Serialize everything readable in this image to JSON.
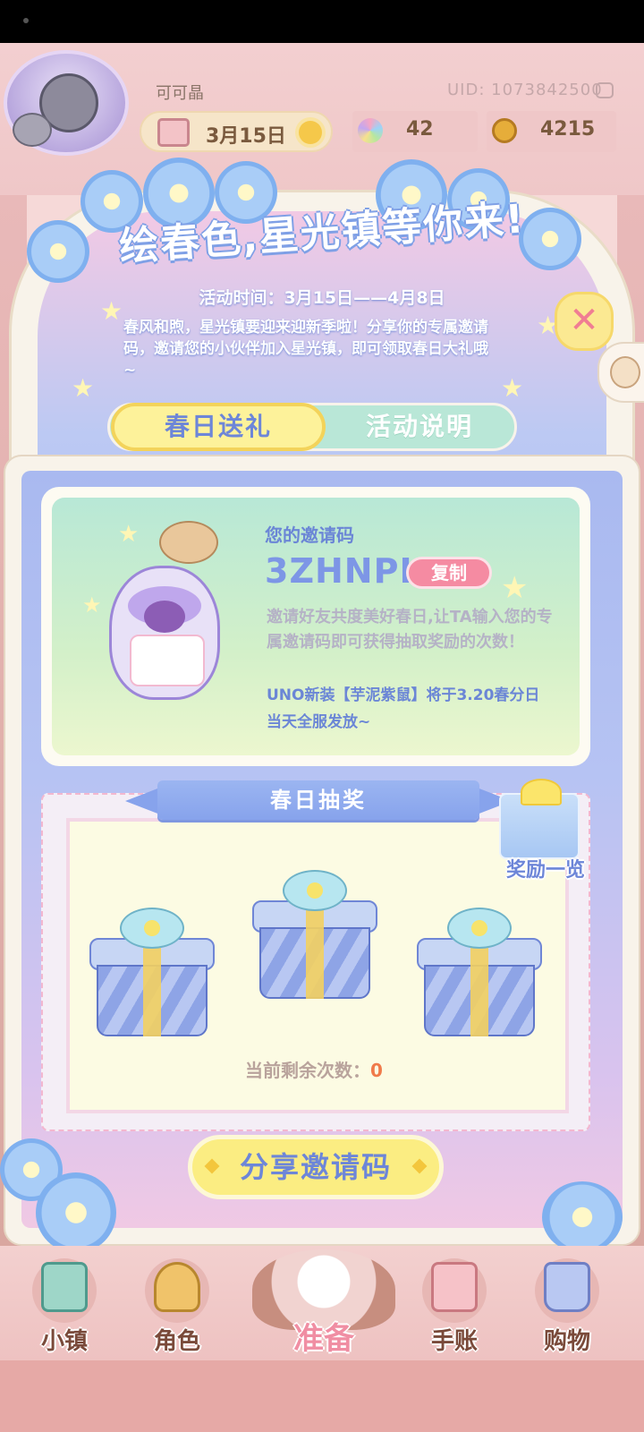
{
  "header": {
    "username": "可可晶",
    "uid": "UID: 1073842500",
    "date": "3月15日",
    "flower_count": "42",
    "coin_count": "4215"
  },
  "event": {
    "title": "绘春色,星光镇等你来!",
    "time": "活动时间：3月15日——4月8日",
    "description": "春风和煦，星光镇要迎来迎新季啦！分享你的专属邀请码，邀请您的小伙伴加入星光镇，即可领取春日大礼哦~",
    "close_symbol": "✕"
  },
  "tabs": {
    "active": "春日送礼",
    "inactive": "活动说明"
  },
  "invite": {
    "label": "您的邀请码",
    "code": "3ZHNPH",
    "copy_label": "复制",
    "description": "邀请好友共度美好春日,让TA输入您的专属邀请码即可获得抽取奖励的次数！",
    "note": "UNO新装【芋泥紫鼠】将于3.20春分日当天全服发放~"
  },
  "lottery": {
    "title": "春日抽奖",
    "rewards_label": "奖励一览",
    "remaining_label": "当前剩余次数：",
    "remaining_count": "0"
  },
  "share_button": "分享邀请码",
  "nav": {
    "town": "小镇",
    "character": "角色",
    "prepare": "准备",
    "journal": "手账",
    "shopping": "购物"
  },
  "colors": {
    "accent_blue": "#6d86d8",
    "button_yellow": "#fbed82",
    "copy_pink": "#f58ba2",
    "count_orange": "#f07a4a"
  }
}
